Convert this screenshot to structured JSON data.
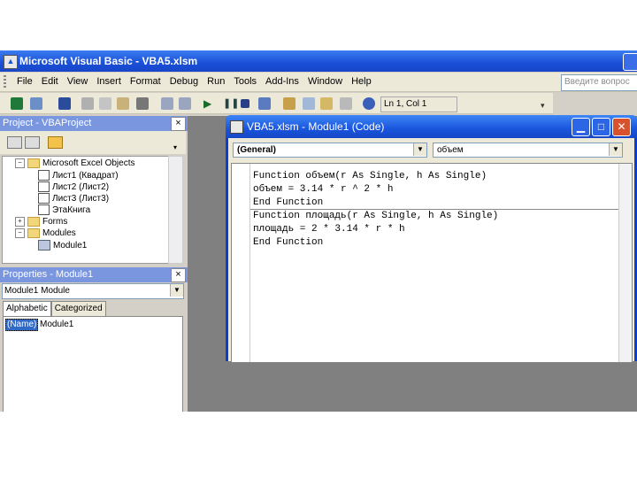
{
  "app": {
    "title": "Microsoft Visual Basic - VBA5.xlsm"
  },
  "menu": {
    "items": [
      "File",
      "Edit",
      "View",
      "Insert",
      "Format",
      "Debug",
      "Run",
      "Tools",
      "Add-Ins",
      "Window",
      "Help"
    ],
    "ask_box": "Введите вопрос"
  },
  "toolbar": {
    "position_text": "Ln 1, Col 1",
    "icons": [
      "excel-icon",
      "insert-module-icon",
      "save-icon",
      "cut-icon",
      "copy-icon",
      "paste-icon",
      "find-icon",
      "undo-icon",
      "redo-icon",
      "run-icon",
      "pause-icon",
      "reset-icon",
      "design-mode-icon",
      "project-explorer-icon",
      "properties-icon",
      "object-browser-icon",
      "toolbox-icon",
      "help-icon"
    ]
  },
  "project": {
    "title": "Project - VBAProject",
    "close": "×",
    "tree": {
      "excel_objects": "Microsoft Excel Objects",
      "sheet1": "Лист1 (Квадрат)",
      "sheet2": "Лист2 (Лист2)",
      "sheet3": "Лист3 (Лист3)",
      "workbook": "ЭтаКнига",
      "forms": "Forms",
      "modules": "Modules",
      "module1": "Module1"
    }
  },
  "properties": {
    "title": "Properties - Module1",
    "close": "×",
    "object_combo": "Module1 Module",
    "tabs": [
      "Alphabetic",
      "Categorized"
    ],
    "rows": [
      {
        "name": "(Name)",
        "value": "Module1"
      }
    ]
  },
  "code_window": {
    "title": "VBA5.xlsm - Module1 (Code)",
    "object_combo": "(General)",
    "proc_combo": "объем",
    "lines": [
      "Function объем(r As Single, h As Single)",
      "объем = 3.14 * r ^ 2 * h",
      "End Function",
      "Function площадь(r As Single, h As Single)",
      "площадь = 2 * 3.14 * r * h",
      "End Function"
    ]
  },
  "colors": {
    "title_blue": "#1a4fd8",
    "panel_title": "#7a96df",
    "mdi_gray": "#808080",
    "selection": "#3169c6"
  }
}
